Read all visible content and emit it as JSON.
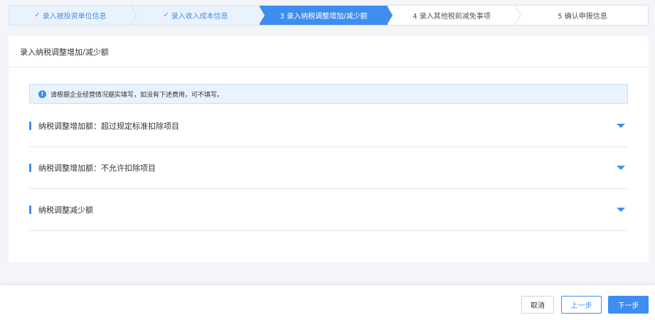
{
  "stepper": {
    "steps": [
      {
        "label": "录入被投资单位信息",
        "state": "done",
        "check": "✓"
      },
      {
        "label": "录入收入成本信息",
        "state": "done",
        "check": "✓"
      },
      {
        "label": "3 录入纳税调整增加/减少额",
        "state": "active"
      },
      {
        "label": "4 录入其他税前减免事项",
        "state": "todo"
      },
      {
        "label": "5 确认申报信息",
        "state": "todo"
      }
    ]
  },
  "card": {
    "title": "录入纳税调整增加/减少额",
    "notice": {
      "icon": "info-icon",
      "icon_glyph": "!",
      "text": "请根据企业经营情况据实填写，如没有下述费用，可不填写。"
    },
    "sections": [
      {
        "label": "纳税调整增加额：超过规定标准扣除项目"
      },
      {
        "label": "纳税调整增加额：不允许扣除项目"
      },
      {
        "label": "纳税调整减少额"
      }
    ]
  },
  "footer": {
    "cancel_label": "取消",
    "prev_label": "上一步",
    "next_label": "下一步"
  },
  "colors": {
    "accent": "#3d8ef0",
    "done_bg": "#eaf3fd",
    "notice_bg": "#e8f3fe"
  }
}
